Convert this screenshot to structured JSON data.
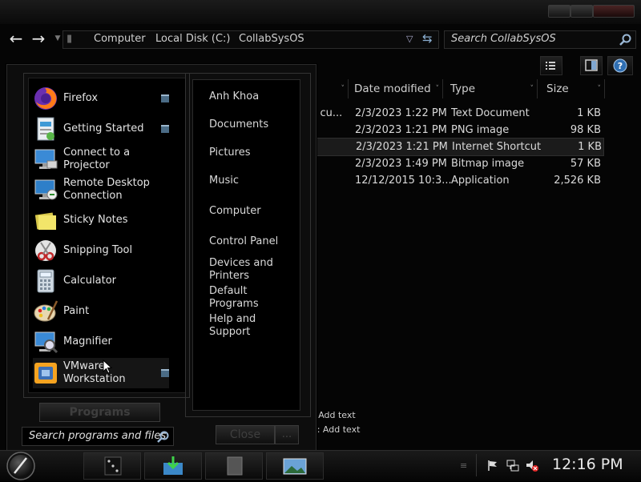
{
  "explorer": {
    "breadcrumb": [
      "Computer",
      "Local Disk (C:)",
      "CollabSysOS"
    ],
    "search_placeholder": "Search CollabSysOS",
    "columns": [
      "Date modified",
      "Type",
      "Size"
    ],
    "rows": [
      {
        "name_fragment": "r cu...",
        "date": "2/3/2023 1:22 PM",
        "type": "Text Document",
        "size": "1 KB"
      },
      {
        "name_fragment": "",
        "date": "2/3/2023 1:21 PM",
        "type": "PNG image",
        "size": "98 KB"
      },
      {
        "name_fragment": "",
        "date": "2/3/2023 1:21 PM",
        "type": "Internet Shortcut",
        "size": "1 KB"
      },
      {
        "name_fragment": "",
        "date": "2/3/2023 1:49 PM",
        "type": "Bitmap image",
        "size": "57 KB"
      },
      {
        "name_fragment": "",
        "date": "12/12/2015 10:3...",
        "type": "Application",
        "size": "2,526 KB"
      }
    ],
    "details": [
      ": Add text",
      "s: Add text"
    ]
  },
  "start_menu": {
    "apps": [
      {
        "label": "Firefox",
        "icon": "firefox-icon"
      },
      {
        "label": "Getting Started",
        "icon": "getting-started-icon"
      },
      {
        "label": "Connect to a Projector",
        "icon": "projector-icon"
      },
      {
        "label": "Remote Desktop Connection",
        "icon": "remote-desktop-icon"
      },
      {
        "label": "Sticky Notes",
        "icon": "sticky-notes-icon"
      },
      {
        "label": "Snipping Tool",
        "icon": "scissors-icon"
      },
      {
        "label": "Calculator",
        "icon": "calculator-icon"
      },
      {
        "label": "Paint",
        "icon": "paint-palette-icon"
      },
      {
        "label": "Magnifier",
        "icon": "magnifier-icon"
      },
      {
        "label": "VMware Workstation",
        "icon": "vmware-icon"
      }
    ],
    "places": [
      "Anh Khoa",
      "Documents",
      "Pictures",
      "Music",
      "Computer",
      "Control Panel",
      "Devices and Printers",
      "Default Programs",
      "Help and Support"
    ],
    "programs_label": "Programs",
    "search_placeholder": "Search programs and files",
    "close_label": "Close"
  },
  "taskbar": {
    "clock": "12:16 PM"
  }
}
